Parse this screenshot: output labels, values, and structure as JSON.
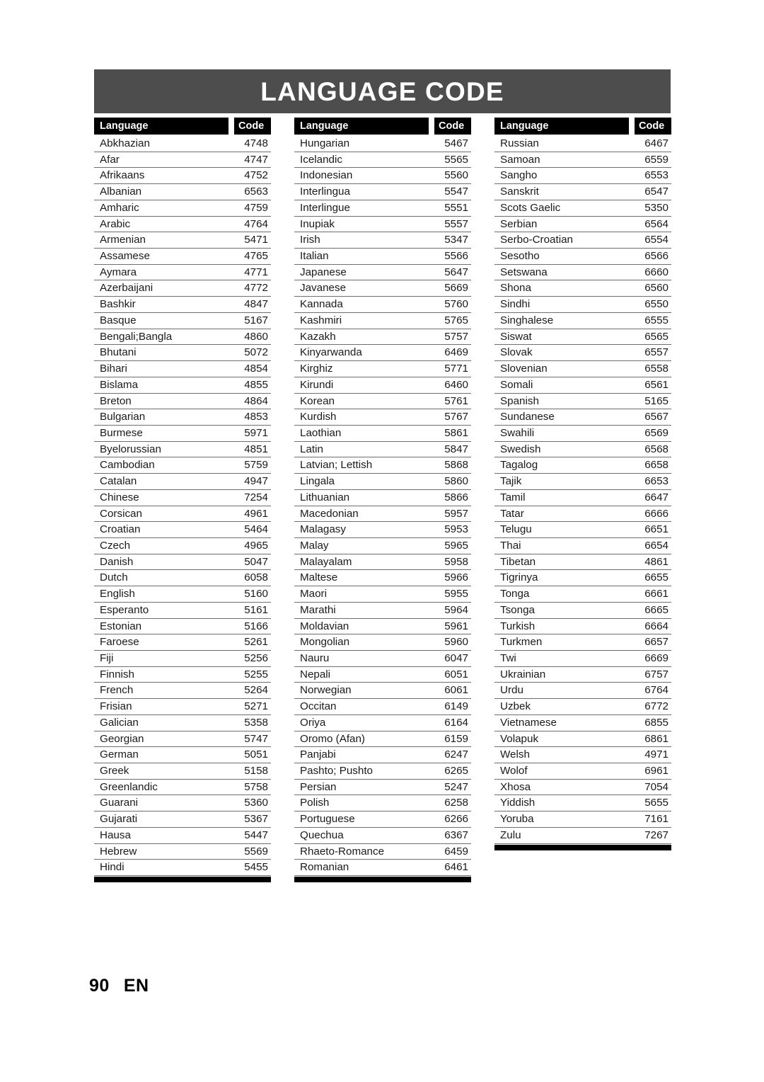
{
  "page": {
    "title": "LANGUAGE CODE",
    "footer_page_number": "90",
    "footer_language": "EN"
  },
  "table": {
    "header_language": "Language",
    "header_code": "Code",
    "columns": [
      {
        "rows": [
          [
            "Abkhazian",
            "4748"
          ],
          [
            "Afar",
            "4747"
          ],
          [
            "Afrikaans",
            "4752"
          ],
          [
            "Albanian",
            "6563"
          ],
          [
            "Amharic",
            "4759"
          ],
          [
            "Arabic",
            "4764"
          ],
          [
            "Armenian",
            "5471"
          ],
          [
            "Assamese",
            "4765"
          ],
          [
            "Aymara",
            "4771"
          ],
          [
            "Azerbaijani",
            "4772"
          ],
          [
            "Bashkir",
            "4847"
          ],
          [
            "Basque",
            "5167"
          ],
          [
            "Bengali;Bangla",
            "4860"
          ],
          [
            "Bhutani",
            "5072"
          ],
          [
            "Bihari",
            "4854"
          ],
          [
            "Bislama",
            "4855"
          ],
          [
            "Breton",
            "4864"
          ],
          [
            "Bulgarian",
            "4853"
          ],
          [
            "Burmese",
            "5971"
          ],
          [
            "Byelorussian",
            "4851"
          ],
          [
            "Cambodian",
            "5759"
          ],
          [
            "Catalan",
            "4947"
          ],
          [
            "Chinese",
            "7254"
          ],
          [
            "Corsican",
            "4961"
          ],
          [
            "Croatian",
            "5464"
          ],
          [
            "Czech",
            "4965"
          ],
          [
            "Danish",
            "5047"
          ],
          [
            "Dutch",
            "6058"
          ],
          [
            "English",
            "5160"
          ],
          [
            "Esperanto",
            "5161"
          ],
          [
            "Estonian",
            "5166"
          ],
          [
            "Faroese",
            "5261"
          ],
          [
            "Fiji",
            "5256"
          ],
          [
            "Finnish",
            "5255"
          ],
          [
            "French",
            "5264"
          ],
          [
            "Frisian",
            "5271"
          ],
          [
            "Galician",
            "5358"
          ],
          [
            "Georgian",
            "5747"
          ],
          [
            "German",
            "5051"
          ],
          [
            "Greek",
            "5158"
          ],
          [
            "Greenlandic",
            "5758"
          ],
          [
            "Guarani",
            "5360"
          ],
          [
            "Gujarati",
            "5367"
          ],
          [
            "Hausa",
            "5447"
          ],
          [
            "Hebrew",
            "5569"
          ],
          [
            "Hindi",
            "5455"
          ]
        ]
      },
      {
        "rows": [
          [
            "Hungarian",
            "5467"
          ],
          [
            "Icelandic",
            "5565"
          ],
          [
            "Indonesian",
            "5560"
          ],
          [
            "Interlingua",
            "5547"
          ],
          [
            "Interlingue",
            "5551"
          ],
          [
            "Inupiak",
            "5557"
          ],
          [
            "Irish",
            "5347"
          ],
          [
            "Italian",
            "5566"
          ],
          [
            "Japanese",
            "5647"
          ],
          [
            "Javanese",
            "5669"
          ],
          [
            "Kannada",
            "5760"
          ],
          [
            "Kashmiri",
            "5765"
          ],
          [
            "Kazakh",
            "5757"
          ],
          [
            "Kinyarwanda",
            "6469"
          ],
          [
            "Kirghiz",
            "5771"
          ],
          [
            "Kirundi",
            "6460"
          ],
          [
            "Korean",
            "5761"
          ],
          [
            "Kurdish",
            "5767"
          ],
          [
            "Laothian",
            "5861"
          ],
          [
            "Latin",
            "5847"
          ],
          [
            "Latvian; Lettish",
            "5868"
          ],
          [
            "Lingala",
            "5860"
          ],
          [
            "Lithuanian",
            "5866"
          ],
          [
            "Macedonian",
            "5957"
          ],
          [
            "Malagasy",
            "5953"
          ],
          [
            "Malay",
            "5965"
          ],
          [
            "Malayalam",
            "5958"
          ],
          [
            "Maltese",
            "5966"
          ],
          [
            "Maori",
            "5955"
          ],
          [
            "Marathi",
            "5964"
          ],
          [
            "Moldavian",
            "5961"
          ],
          [
            "Mongolian",
            "5960"
          ],
          [
            "Nauru",
            "6047"
          ],
          [
            "Nepali",
            "6051"
          ],
          [
            "Norwegian",
            "6061"
          ],
          [
            "Occitan",
            "6149"
          ],
          [
            "Oriya",
            "6164"
          ],
          [
            "Oromo (Afan)",
            "6159"
          ],
          [
            "Panjabi",
            "6247"
          ],
          [
            "Pashto; Pushto",
            "6265"
          ],
          [
            "Persian",
            "5247"
          ],
          [
            "Polish",
            "6258"
          ],
          [
            "Portuguese",
            "6266"
          ],
          [
            "Quechua",
            "6367"
          ],
          [
            "Rhaeto-Romance",
            "6459"
          ],
          [
            "Romanian",
            "6461"
          ]
        ]
      },
      {
        "rows": [
          [
            "Russian",
            "6467"
          ],
          [
            "Samoan",
            "6559"
          ],
          [
            "Sangho",
            "6553"
          ],
          [
            "Sanskrit",
            "6547"
          ],
          [
            "Scots Gaelic",
            "5350"
          ],
          [
            "Serbian",
            "6564"
          ],
          [
            "Serbo-Croatian",
            "6554"
          ],
          [
            "Sesotho",
            "6566"
          ],
          [
            "Setswana",
            "6660"
          ],
          [
            "Shona",
            "6560"
          ],
          [
            "Sindhi",
            "6550"
          ],
          [
            "Singhalese",
            "6555"
          ],
          [
            "Siswat",
            "6565"
          ],
          [
            "Slovak",
            "6557"
          ],
          [
            "Slovenian",
            "6558"
          ],
          [
            "Somali",
            "6561"
          ],
          [
            "Spanish",
            "5165"
          ],
          [
            "Sundanese",
            "6567"
          ],
          [
            "Swahili",
            "6569"
          ],
          [
            "Swedish",
            "6568"
          ],
          [
            "Tagalog",
            "6658"
          ],
          [
            "Tajik",
            "6653"
          ],
          [
            "Tamil",
            "6647"
          ],
          [
            "Tatar",
            "6666"
          ],
          [
            "Telugu",
            "6651"
          ],
          [
            "Thai",
            "6654"
          ],
          [
            "Tibetan",
            "4861"
          ],
          [
            "Tigrinya",
            "6655"
          ],
          [
            "Tonga",
            "6661"
          ],
          [
            "Tsonga",
            "6665"
          ],
          [
            "Turkish",
            "6664"
          ],
          [
            "Turkmen",
            "6657"
          ],
          [
            "Twi",
            "6669"
          ],
          [
            "Ukrainian",
            "6757"
          ],
          [
            "Urdu",
            "6764"
          ],
          [
            "Uzbek",
            "6772"
          ],
          [
            "Vietnamese",
            "6855"
          ],
          [
            "Volapuk",
            "6861"
          ],
          [
            "Welsh",
            "4971"
          ],
          [
            "Wolof",
            "6961"
          ],
          [
            "Xhosa",
            "7054"
          ],
          [
            "Yiddish",
            "5655"
          ],
          [
            "Yoruba",
            "7161"
          ],
          [
            "Zulu",
            "7267"
          ]
        ]
      }
    ]
  },
  "colors": {
    "title_bar": "#4d4d4d",
    "header_block": "#000000",
    "rule": "#6e6e6e",
    "text": "#1a1a1a"
  }
}
